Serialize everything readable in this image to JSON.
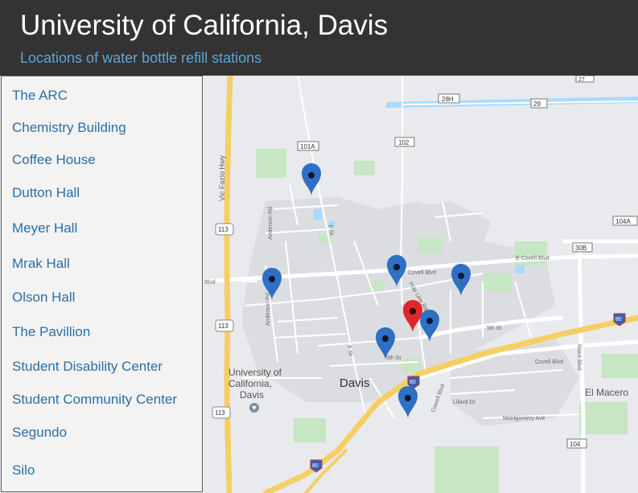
{
  "header": {
    "title": "University of California, Davis",
    "subtitle": "Locations of water bottle refill stations"
  },
  "sidebar": {
    "items": [
      {
        "label": "The ARC"
      },
      {
        "label": "Chemistry Building"
      },
      {
        "label": "Coffee House"
      },
      {
        "label": "Dutton Hall"
      },
      {
        "label": "Meyer Hall"
      },
      {
        "label": "Mrak Hall"
      },
      {
        "label": "Olson Hall"
      },
      {
        "label": "The Pavillion"
      },
      {
        "label": "Student Disability Center"
      },
      {
        "label": "Student Community Center"
      },
      {
        "label": "Segundo"
      },
      {
        "label": "Silo"
      }
    ]
  },
  "map": {
    "labels": {
      "city": "Davis",
      "campus_line1": "University of",
      "campus_line2": "California,",
      "campus_line3": "Davis",
      "el_macero": "El Macero",
      "vic_fazio": "Vic Fazio Hwy",
      "e_covell": "E Covell Blvd",
      "covell": "Covell Blvd",
      "covell_2": "Covell Blvd",
      "fifth_st": "5th St",
      "fifth_st_2": "5th St",
      "f_st": "F St",
      "f_st_2": "F St",
      "anderson": "Anderson Rd",
      "mace": "Mace Blvd",
      "montgomery": "Montgomery Ave",
      "lillard": "Lillard Dr",
      "cowell": "Cowell Blvd",
      "pole_line": "Pole Line Rd",
      "blvd_left": "Blvd",
      "rd_101a": "101A",
      "rd_102": "102",
      "rd_28h": "28H",
      "rd_29": "29",
      "rd_104a": "104A",
      "rd_30b": "30B",
      "rd_104": "104",
      "rd_27": "27",
      "hwy_113": "113",
      "hwy_113b": "113",
      "hwy_113c": "113",
      "i80": "80",
      "i80b": "80",
      "i80c": "80"
    },
    "colors": {
      "pin_blue": "#2f6fc4",
      "pin_red": "#e0262b",
      "highway": "#f5cf63",
      "park": "#c6e6c4",
      "water": "#aadaff",
      "land": "#e8eaed",
      "urban": "#dcdde1"
    },
    "icons": {
      "pin": "map-marker-icon",
      "shield": "highway-shield-icon"
    }
  }
}
